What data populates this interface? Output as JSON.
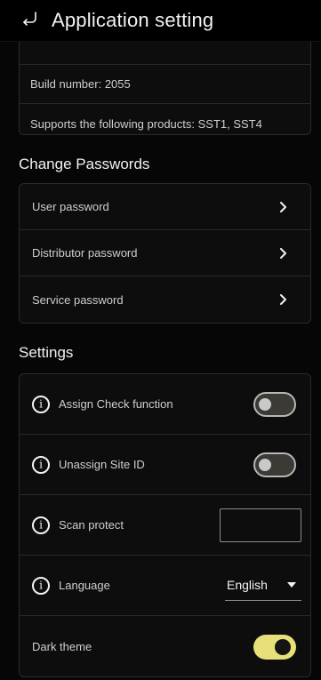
{
  "header": {
    "title": "Application setting",
    "back_icon": "return-arrow-icon"
  },
  "about": {
    "items": [
      {
        "label": "Build number: 2055"
      },
      {
        "label": "Supports the following products: SST1, SST4"
      }
    ]
  },
  "sections": {
    "change_passwords_title": "Change Passwords",
    "settings_title": "Settings"
  },
  "passwords": {
    "items": [
      {
        "label": "User password",
        "icon": "chevron-right-icon"
      },
      {
        "label": "Distributor password",
        "icon": "chevron-right-icon"
      },
      {
        "label": "Service password",
        "icon": "chevron-right-icon"
      }
    ]
  },
  "settings": {
    "assign_check_function": {
      "label": "Assign Check function",
      "enabled": false,
      "icon": "info-icon"
    },
    "unassign_site_id": {
      "label": "Unassign Site ID",
      "enabled": false,
      "icon": "info-icon"
    },
    "scan_protect": {
      "label": "Scan protect",
      "value": "",
      "icon": "info-icon"
    },
    "language": {
      "label": "Language",
      "selected": "English",
      "icon": "info-icon"
    },
    "dark_theme": {
      "label": "Dark theme",
      "enabled": true
    }
  },
  "colors": {
    "background": "#060606",
    "accent": "#e7df7a"
  }
}
